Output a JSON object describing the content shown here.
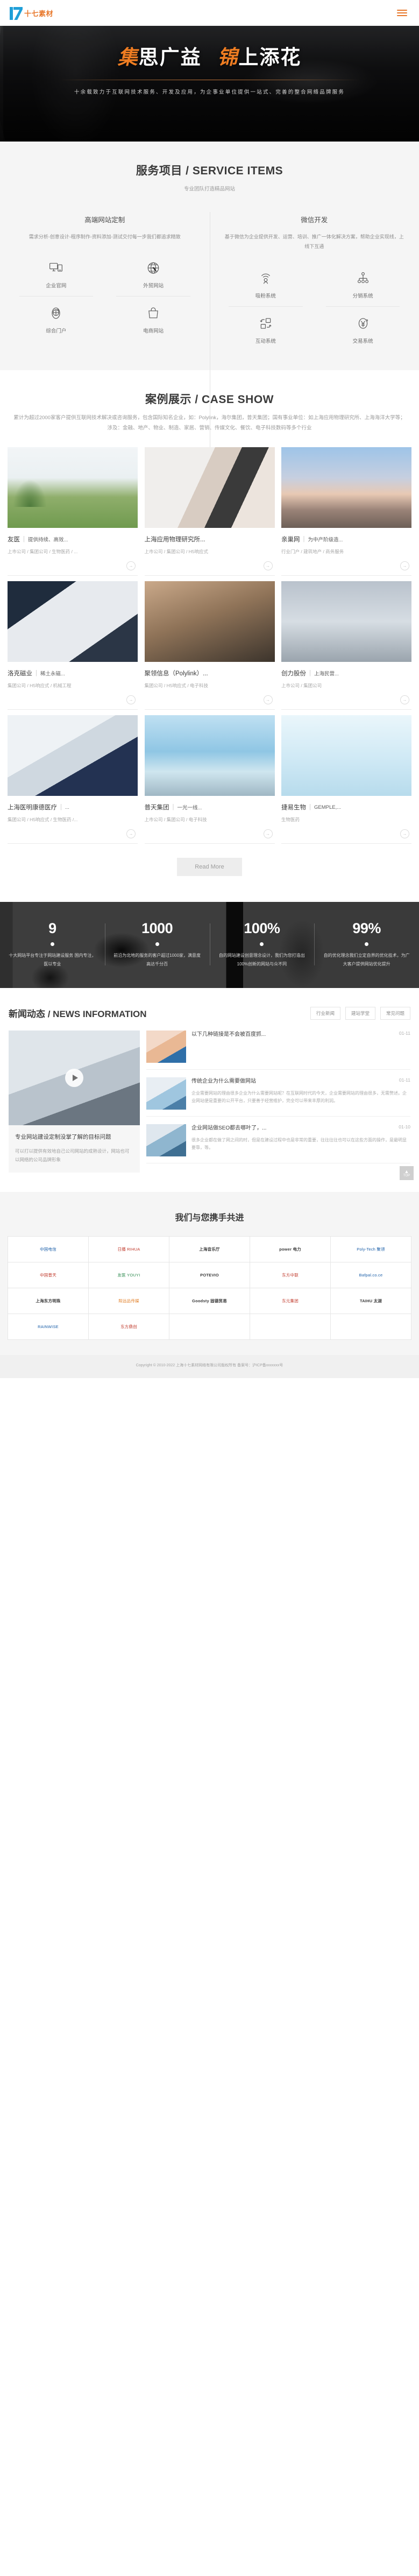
{
  "header": {
    "logo_text": "十七素材",
    "menu_icon": "hamburger-icon"
  },
  "hero": {
    "title_part1": "集",
    "title_part2": "思广益",
    "title_part3": "锦",
    "title_part4": "上添花",
    "subtitle": "十余载致力于互联网技术服务、开发及应用，为企事业单位提供一站式、完善的整合网络品牌服务"
  },
  "services": {
    "title": "服务项目 / SERVICE ITEMS",
    "subtitle": "专业团队打造精品网站",
    "columns": [
      {
        "name": "高端网站定制",
        "desc": "需求分析-创意设计-程序制作-资料添加-测试交付每一步我们都追求精致",
        "items": [
          {
            "label": "企业官网",
            "icon": "monitor-mobile-icon"
          },
          {
            "label": "外贸网站",
            "icon": "globe-icon"
          },
          {
            "label": "综合门户",
            "icon": "portal-globe-icon"
          },
          {
            "label": "电商网站",
            "icon": "shopping-bag-icon"
          }
        ]
      },
      {
        "name": "微信开发",
        "desc": "基于微信为企业提供开发、运营、培训、推广一体化解决方案，帮助企业实现线，上线下互通",
        "items": [
          {
            "label": "吸粉系统",
            "icon": "broadcast-person-icon"
          },
          {
            "label": "分销系统",
            "icon": "network-tree-icon"
          },
          {
            "label": "互动系统",
            "icon": "exchange-boxes-icon"
          },
          {
            "label": "交易系统",
            "icon": "yuan-circle-icon"
          }
        ]
      }
    ]
  },
  "cases": {
    "title": "案例展示 / CASE SHOW",
    "subtitle": "累计为超过2000家客户提供互联网技术解决或咨询服务，包含国际知名企业，如：Polylink，海尔集团，普天集团；国有事业单位：如上海应用物理研究所、上海海洋大学等；涉及：金融、地产、物业、制造、家居、营销、传媒文化、餐饮、电子科技数码等多个行业",
    "read_more": "Read More",
    "items": [
      {
        "name": "友医",
        "desc": "提供持续、高效...",
        "tags": "上市公司 / 集团公司 / 生物医药 / ...",
        "photo": "ph-park",
        "arrow": "arrow-right-icon"
      },
      {
        "name": "上海应用物理研究所...",
        "desc": "",
        "tags": "上市公司 / 集团公司 / H5响应式",
        "photo": "ph-micro",
        "arrow": "arrow-right-icon"
      },
      {
        "name": "亲巢网",
        "desc": "为中产阶级造...",
        "tags": "行业门户 / 建筑地产 / 商务服务",
        "photo": "ph-villa",
        "arrow": "arrow-right-icon"
      },
      {
        "name": "洛克磁业",
        "desc": "稀土永磁...",
        "tags": "集团公司 / H5响应式 / 机械工程",
        "photo": "ph-laptop",
        "arrow": "arrow-right-icon"
      },
      {
        "name": "聚领信息（Polylink）...",
        "desc": "",
        "tags": "集团公司 / H5响应式 / 电子科技",
        "photo": "ph-office",
        "arrow": "arrow-right-icon"
      },
      {
        "name": "创力股份",
        "desc": "上海民营...",
        "tags": "上市公司 / 集团公司",
        "photo": "ph-robot",
        "arrow": "arrow-right-icon"
      },
      {
        "name": "上海医明康德医疗",
        "desc": "...",
        "tags": "集团公司 / H5响应式 / 生物医药 /...",
        "photo": "ph-doctor",
        "arrow": "arrow-right-icon"
      },
      {
        "name": "普天集团",
        "desc": "一光一线...",
        "tags": "上市公司 / 集团公司 / 电子科技",
        "photo": "ph-sea",
        "arrow": "arrow-right-icon"
      },
      {
        "name": "捷易生物",
        "desc": "GEMPLE,...",
        "tags": "生物医药",
        "photo": "ph-dna",
        "arrow": "arrow-right-icon"
      }
    ]
  },
  "stats": [
    {
      "number": "9",
      "text": "十大网站平台专注于网站建设服务\n国内专注，医以专业"
    },
    {
      "number": "1000",
      "text": "前沿为北地的服务的客户超过1000家，满意度高达千分百"
    },
    {
      "number": "100%",
      "text": "自的网站建设创意理念设计，我们为您打造出100%创新的网站与众不同"
    },
    {
      "number": "99%",
      "text": "自的优化理念我们立定自界的优化技术，为广大客户提供网站优化提升"
    }
  ],
  "news": {
    "title": "新闻动态 / NEWS INFORMATION",
    "tabs": [
      {
        "label": "行业新闻",
        "active": false
      },
      {
        "label": "建站学堂",
        "active": false
      },
      {
        "label": "常见问题",
        "active": false
      }
    ],
    "feature": {
      "title": "专业网站建设定制没掌了解的目标问题",
      "desc": "可以打以提供有效地自己公司网站的成熟设计，网站也可以网络的公司品牌形象",
      "play_icon": "play-icon",
      "photo": "ph-news1"
    },
    "items": [
      {
        "title": "以下几种链接是不会被百度抓...",
        "date": "01-11",
        "desc": "",
        "photo": "ph-news2"
      },
      {
        "title": "传统企业为什么需要做网站",
        "date": "01-11",
        "desc": "企业需要网站的理由很多企业为什么需要网站呢？在互联网时代的今天，企业需要网站的理由很多，无需赘述。企业网站便是重要的公开平台，只要善于经营维护，完全可以带来丰厚的利润。",
        "photo": "ph-news3"
      },
      {
        "title": "企业网站做SEO都去哪叶了，...",
        "date": "01-10",
        "desc": "很多企业都在做了网之间的时，但是在建设过程中也是非常的重要，往往往往也可以在这些方面的操作，是最明显要靠，等。",
        "photo": "ph-news4"
      }
    ]
  },
  "partners": {
    "title": "我们与您携手共进",
    "logos": [
      {
        "text": "中国电信",
        "color": "c-blue"
      },
      {
        "text": "日播 RIHUA",
        "color": "c-red"
      },
      {
        "text": "上海音乐厅",
        "color": "c-dark"
      },
      {
        "text": "power 电力",
        "color": "c-dark"
      },
      {
        "text": "Poly-Tech 聚领",
        "color": "c-blue"
      },
      {
        "text": "中国普天",
        "color": "c-red"
      },
      {
        "text": "友医 YOUYI",
        "color": "c-green"
      },
      {
        "text": "POTEVIO",
        "color": "c-dark"
      },
      {
        "text": "东方中联",
        "color": "c-red"
      },
      {
        "text": "Bafpal.co.ce",
        "color": "c-blue"
      },
      {
        "text": "上海东方明珠",
        "color": "c-dark"
      },
      {
        "text": "阳远品传媒",
        "color": "c-orange"
      },
      {
        "text": "Goodsty 固德贸易",
        "color": "c-dark"
      },
      {
        "text": "东元集团",
        "color": "c-red"
      },
      {
        "text": "TAIHU 太湖",
        "color": "c-dark"
      },
      {
        "text": "RAINWISE",
        "color": "c-blue"
      },
      {
        "text": "东方鼎创",
        "color": "c-red"
      }
    ]
  },
  "footer": {
    "text": "Copyright © 2010-2022 上海十七素材网络有限公司版权所有 备案号：沪ICP备xxxxxxx号",
    "totop_caret": "▲",
    "totop_label": "TOP"
  }
}
